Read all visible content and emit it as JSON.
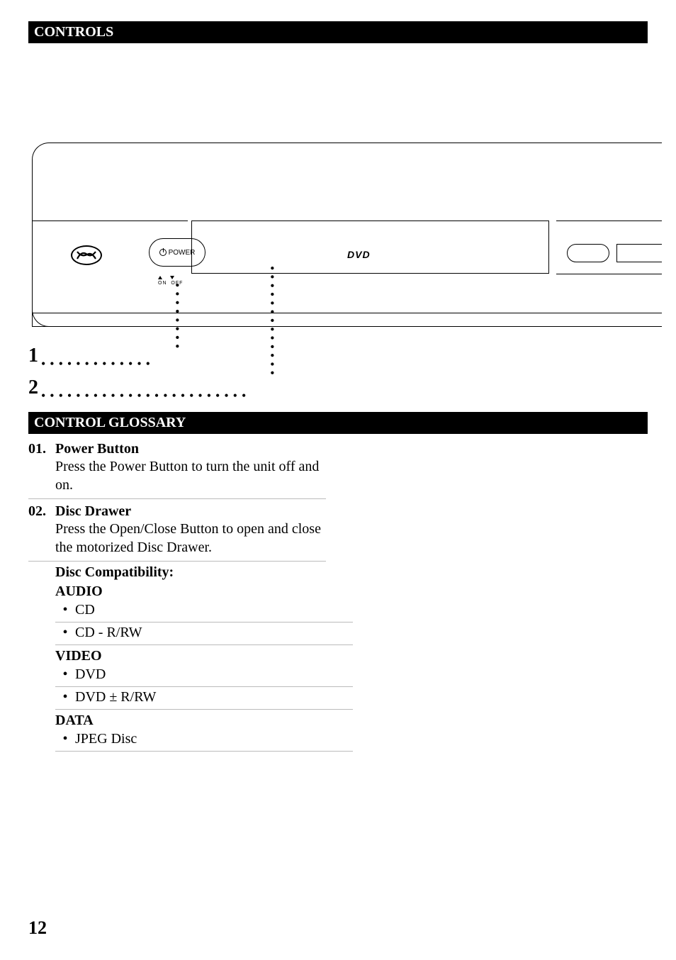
{
  "header": {
    "controls": "CONTROLS",
    "glossary": "CONTROL GLOSSARY"
  },
  "diagram": {
    "power_label": "POWER",
    "on_label": "ON",
    "off_label": "OFF",
    "dvd_label": "DVD",
    "callout_1": "1",
    "callout_2": "2"
  },
  "glossary": {
    "items": [
      {
        "num": "01.",
        "title": "Power Button",
        "desc": "Press the Power Button to turn the unit off and on."
      },
      {
        "num": "02.",
        "title": "Disc Drawer",
        "desc": "Press the Open/Close Button to open and close the motorized Disc Drawer."
      }
    ],
    "compat": {
      "heading": "Disc Compatibility:",
      "audio_label": "AUDIO",
      "audio_items": [
        "CD",
        "CD - R/RW"
      ],
      "video_label": "VIDEO",
      "video_items": [
        "DVD",
        "DVD ± R/RW"
      ],
      "data_label": "DATA",
      "data_items": [
        "JPEG Disc"
      ]
    }
  },
  "page_number": "12"
}
